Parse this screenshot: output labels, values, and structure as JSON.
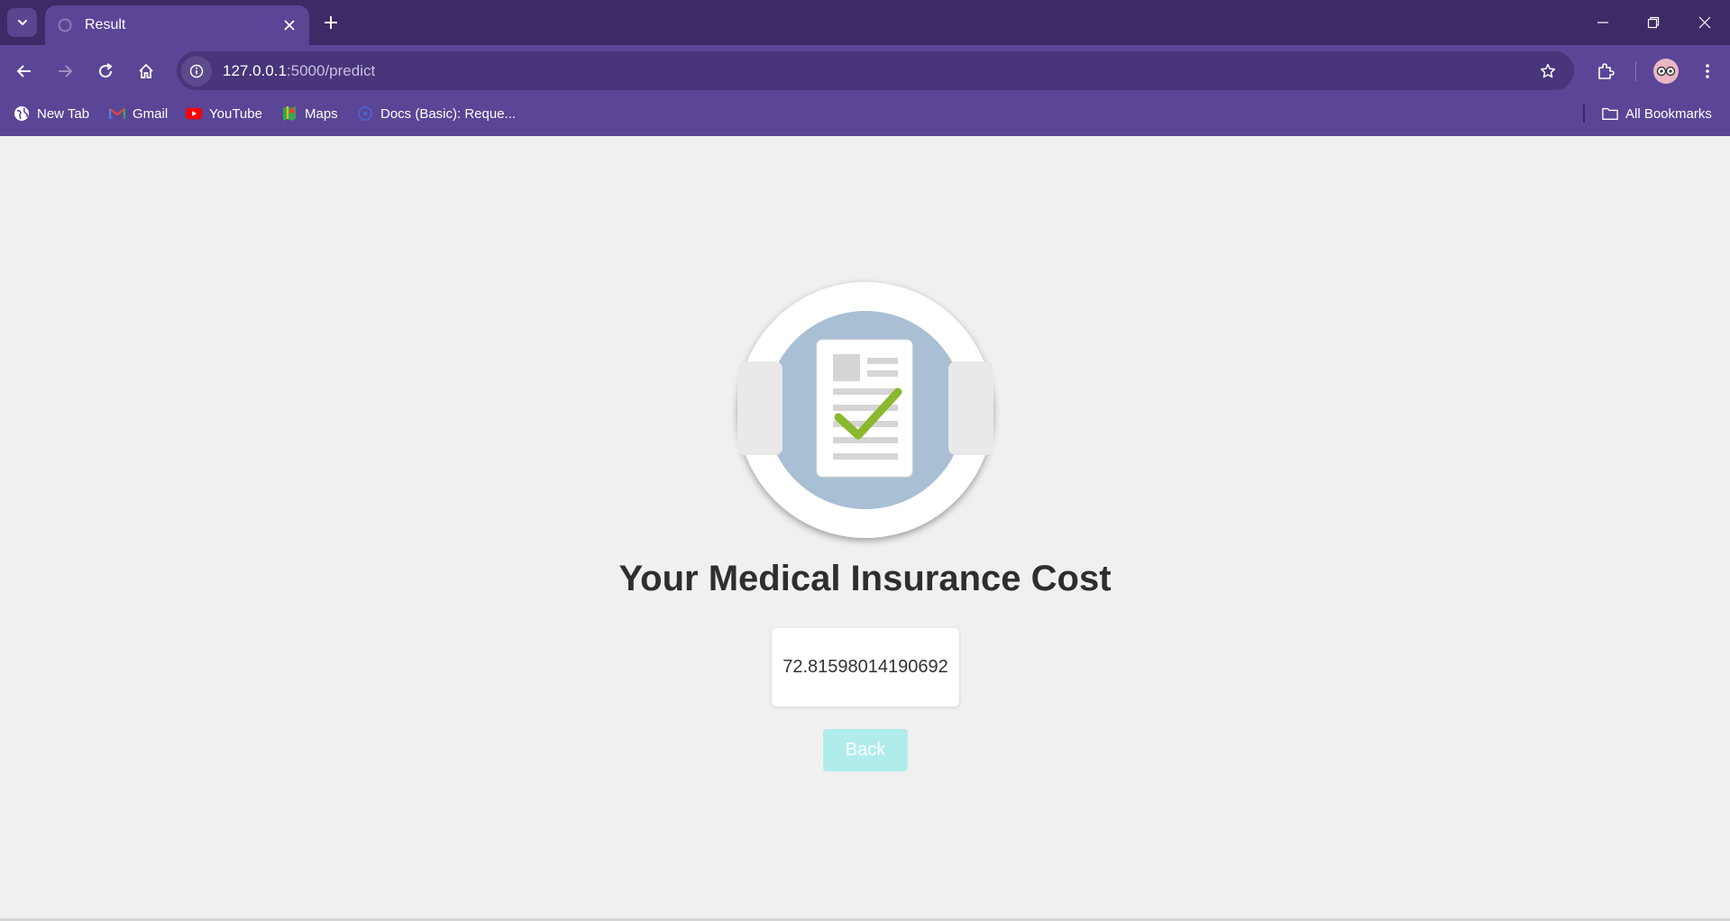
{
  "browser": {
    "tab": {
      "title": "Result"
    },
    "address_bar": {
      "url_host": "127.0.0.1",
      "url_path": ":5000/predict"
    },
    "bookmarks": [
      {
        "label": "New Tab",
        "icon": "globe-icon"
      },
      {
        "label": "Gmail",
        "icon": "gmail-icon"
      },
      {
        "label": "YouTube",
        "icon": "youtube-icon"
      },
      {
        "label": "Maps",
        "icon": "maps-icon"
      },
      {
        "label": "Docs (Basic): Reque...",
        "icon": "docs-icon"
      }
    ],
    "all_bookmarks_label": "All Bookmarks",
    "colors": {
      "tabbar": "#3d2a66",
      "toolbar": "#5b4596",
      "omnibox": "#48357a"
    }
  },
  "page": {
    "heading": "Your Medical Insurance Cost",
    "result_value": "72.81598014190692",
    "back_label": "Back",
    "illustration": "document-checkmark-icon",
    "colors": {
      "background": "#f0f0f0",
      "back_button": "#b0ecec",
      "check": "#8ab82e",
      "circle": "#a9bfd3"
    }
  }
}
